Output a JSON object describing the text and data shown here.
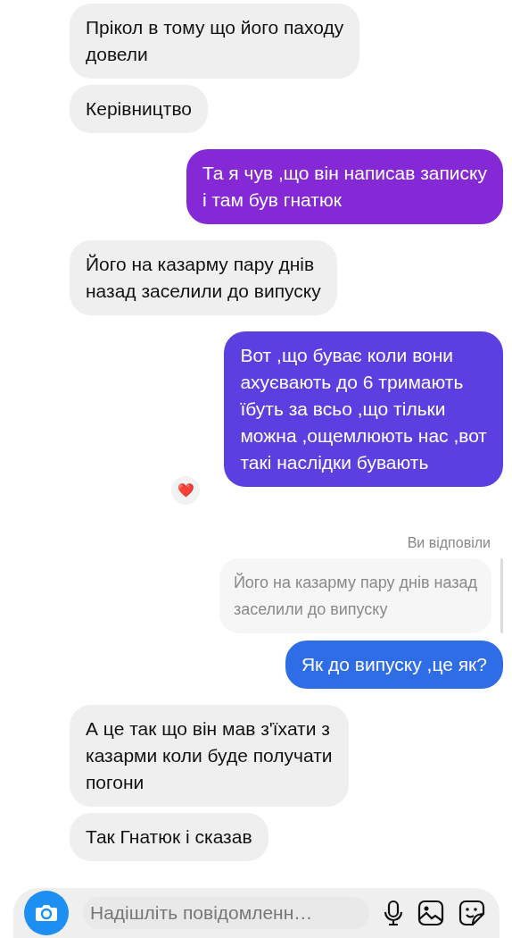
{
  "messages": [
    {
      "kind": "received",
      "lines": [
        "Прікол в тому що його паходу",
        "довели"
      ]
    },
    {
      "kind": "received",
      "lines": [
        "Керівництво"
      ]
    },
    {
      "kind": "sent",
      "color": "#8529d6",
      "lines": [
        "Та я чув ,що він написав записку",
        "і там був гнатюк"
      ]
    },
    {
      "kind": "received",
      "lines": [
        "Його на казарму пару днів",
        "назад заселили до випуску"
      ]
    },
    {
      "kind": "sent",
      "color": "#5b3fe0",
      "lines": [
        "Вот ,що буває коли вони",
        "ахуєвають до 6 тримають",
        "їбуть за всьо ,що тільки",
        "можна ,ощемлюють нас ,вот",
        "такі наслідки бувають"
      ],
      "reaction": "❤️"
    },
    {
      "kind": "reply",
      "label": "Ви відповіли",
      "lines": [
        "Його на казарму пару днів назад",
        "заселили до випуску"
      ]
    },
    {
      "kind": "sent",
      "color": "#2f6de6",
      "lines": [
        "Як до випуску ,це як?"
      ]
    },
    {
      "kind": "received",
      "lines": [
        "А це так що він мав з'їхати з",
        "казарми коли буде получати",
        "погони"
      ]
    },
    {
      "kind": "received",
      "lines": [
        "Так Гнатюк і сказав"
      ]
    }
  ],
  "composer": {
    "placeholder": "Надішліть повідомленн…"
  }
}
